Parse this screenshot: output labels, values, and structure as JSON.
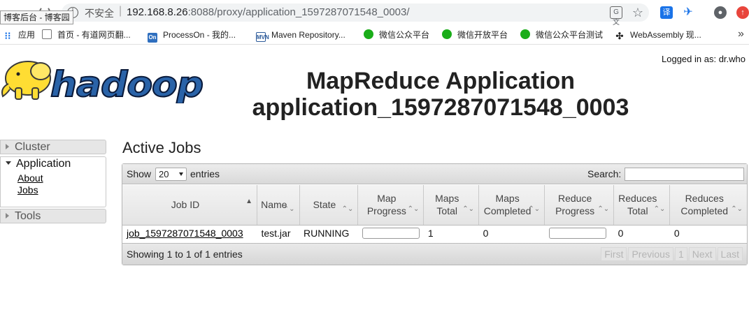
{
  "browser": {
    "tooltip": "博客后台 - 博客园",
    "security_label": "不安全",
    "url_host": "192.168.8.26",
    "url_path": ":8088/proxy/application_1597287071548_0003/",
    "icons": [
      "info-icon",
      "translate-icon",
      "star-icon",
      "extension-translate-icon",
      "extension-bird-icon",
      "account-icon",
      "update-icon"
    ],
    "bookmarks": [
      {
        "label": "应用",
        "icon": "apps-grid-icon"
      },
      {
        "label": "首页 - 有道网页翻...",
        "icon": "document-icon"
      },
      {
        "label": "ProcessOn - 我的...",
        "icon": "processon-icon"
      },
      {
        "label": "Maven Repository...",
        "icon": "maven-icon"
      },
      {
        "label": "微信公众平台",
        "icon": "wechat-icon"
      },
      {
        "label": "微信开放平台",
        "icon": "wechat-icon"
      },
      {
        "label": "微信公众平台测试",
        "icon": "wechat-icon"
      },
      {
        "label": "WebAssembly 现...",
        "icon": "webassembly-icon"
      }
    ]
  },
  "header": {
    "logged_in": "Logged in as: dr.who",
    "logo_text": "hadoop",
    "title_line1": "MapReduce Application",
    "title_line2": "application_1597287071548_0003"
  },
  "nav": {
    "cluster": "Cluster",
    "application": "Application",
    "application_links": [
      "About",
      "Jobs"
    ],
    "tools": "Tools"
  },
  "main": {
    "heading": "Active Jobs",
    "show_label": "Show",
    "page_size": "20",
    "entries_label": "entries",
    "search_label": "Search:",
    "search_value": "",
    "columns": [
      "Job ID",
      "Name",
      "State",
      "Map Progress",
      "Maps Total",
      "Maps Completed",
      "Reduce Progress",
      "Reduces Total",
      "Reduces Completed"
    ],
    "rows": [
      {
        "job_id": "job_1597287071548_0003",
        "name": "test.jar",
        "state": "RUNNING",
        "map_progress": 0,
        "maps_total": "1",
        "maps_completed": "0",
        "reduce_progress": 0,
        "reduces_total": "0",
        "reduces_completed": "0"
      }
    ],
    "info": "Showing 1 to 1 of 1 entries",
    "pagination": [
      "First",
      "Previous",
      "1",
      "Next",
      "Last"
    ]
  }
}
